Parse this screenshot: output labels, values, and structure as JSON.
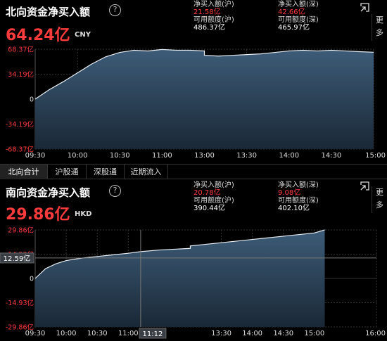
{
  "north": {
    "title": "北向资金净买入额",
    "help_icon": "?",
    "value": "64.24亿",
    "currency": "CNY",
    "stats": {
      "sh_buy_label": "净买入额(沪)",
      "sh_buy_value": "21.58亿",
      "sz_buy_label": "净买入额(深)",
      "sz_buy_value": "42.66亿",
      "sh_quota_label": "可用额度(沪)",
      "sh_quota_value": "486.37亿",
      "sz_quota_label": "可用额度(深)",
      "sz_quota_value": "465.97亿"
    },
    "more_label_1": "更",
    "more_label_2": "多",
    "yticks": [
      "68.37亿",
      "34.19亿",
      "0",
      "-34.19亿",
      "-68.37亿"
    ],
    "xticks": [
      "09:30",
      "10:00",
      "10:30",
      "11:00",
      "13:00",
      "13:30",
      "14:00",
      "14:30",
      "15:00"
    ]
  },
  "tabs": [
    "北向合计",
    "沪股通",
    "深股通",
    "近期流入"
  ],
  "south": {
    "title": "南向资金净买入额",
    "help_icon": "?",
    "value": "29.86亿",
    "currency": "HKD",
    "stats": {
      "sh_buy_label": "净买入额(沪)",
      "sh_buy_value": "20.78亿",
      "sz_buy_label": "净买入额(深)",
      "sz_buy_value": "9.08亿",
      "sh_quota_label": "可用额度(沪)",
      "sh_quota_value": "390.44亿",
      "sz_quota_label": "可用额度(深)",
      "sz_quota_value": "402.10亿"
    },
    "more_label_1": "更",
    "more_label_2": "多",
    "yticks": [
      "29.86亿",
      "14.93亿",
      "0",
      "-14.93亿",
      "-29.86亿"
    ],
    "xticks": [
      "09:30",
      "10:00",
      "10:30",
      "11:00",
      "13:30",
      "14:00",
      "14:30",
      "15:00",
      "16:00"
    ],
    "crosshair_y_label": "12.59亿",
    "crosshair_x_label": "11:12"
  },
  "chart_data": [
    {
      "type": "area",
      "title": "北向资金净买入额",
      "unit": "亿",
      "ylim": [
        -68.37,
        68.37
      ],
      "x": [
        "09:30",
        "09:40",
        "09:50",
        "10:00",
        "10:10",
        "10:20",
        "10:30",
        "10:40",
        "10:50",
        "11:00",
        "11:10",
        "11:20",
        "11:30",
        "13:00",
        "13:10",
        "13:20",
        "13:30",
        "13:40",
        "13:50",
        "14:00",
        "14:10",
        "14:20",
        "14:30",
        "14:40",
        "14:50",
        "15:00"
      ],
      "values": [
        0,
        13,
        24,
        36,
        48,
        58,
        64,
        67,
        66,
        68,
        67,
        67,
        66,
        60,
        59,
        60,
        61,
        62,
        64,
        66,
        67,
        66,
        67,
        66,
        65,
        64.24
      ]
    },
    {
      "type": "area",
      "title": "南向资金净买入额",
      "unit": "亿",
      "ylim": [
        -29.86,
        29.86
      ],
      "x": [
        "09:30",
        "09:40",
        "09:50",
        "10:00",
        "10:15",
        "10:30",
        "10:45",
        "11:00",
        "11:12",
        "11:30",
        "12:00",
        "13:00",
        "13:30",
        "14:00",
        "14:30",
        "15:00",
        "15:10"
      ],
      "values": [
        0,
        6,
        9,
        11,
        12.5,
        13.5,
        14.5,
        15.5,
        16.5,
        17.5,
        18.5,
        20,
        22,
        24,
        26,
        28,
        29.86
      ]
    }
  ]
}
